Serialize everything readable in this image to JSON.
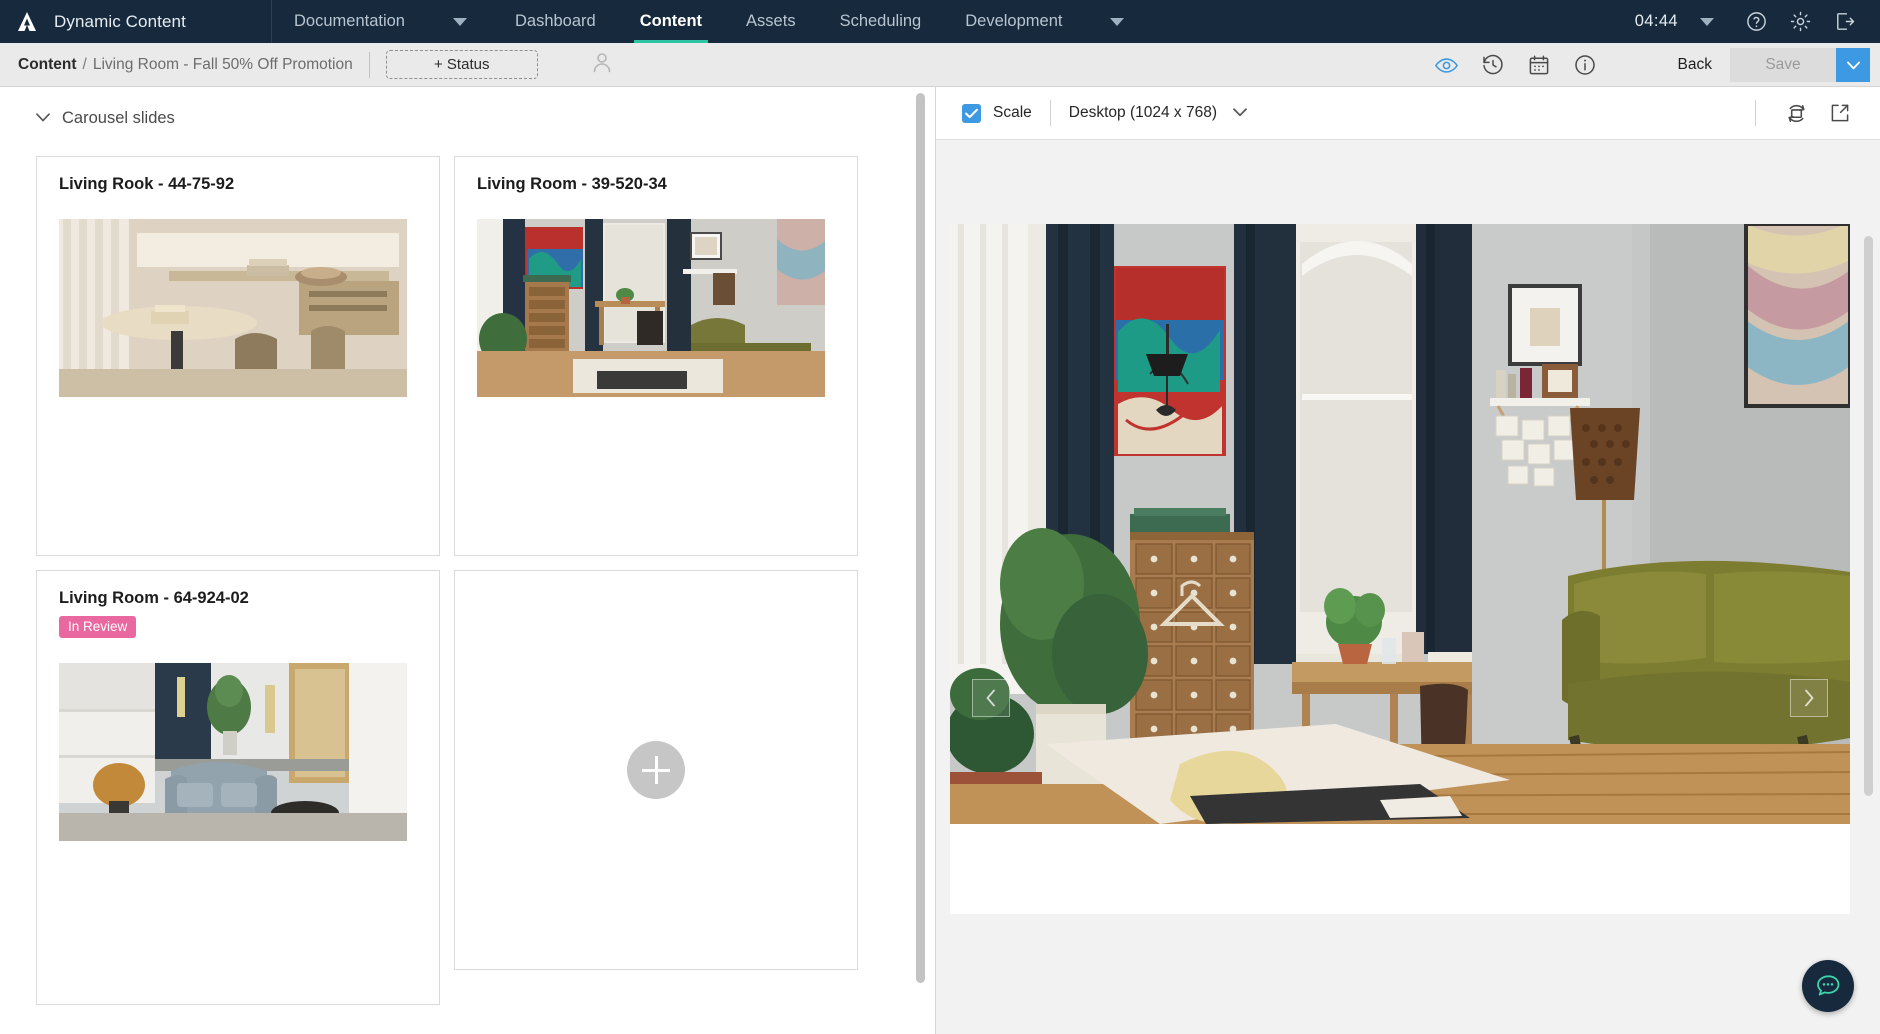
{
  "topnav": {
    "logo_icon": "amplience-logo-icon",
    "app_title": "Dynamic Content",
    "items": [
      {
        "label": "Documentation",
        "active": false,
        "has_caret": true
      },
      {
        "label": "Dashboard",
        "active": false,
        "has_caret": false
      },
      {
        "label": "Content",
        "active": true,
        "has_caret": false
      },
      {
        "label": "Assets",
        "active": false,
        "has_caret": false
      },
      {
        "label": "Scheduling",
        "active": false,
        "has_caret": false
      },
      {
        "label": "Development",
        "active": false,
        "has_caret": true
      }
    ],
    "clock": "04:44",
    "clock_caret_icon": "chevron-down-icon",
    "help_icon": "help-circle-icon",
    "settings_icon": "gear-icon",
    "logout_icon": "logout-icon",
    "accent_active": "#2ec4a4",
    "background": "#16293d"
  },
  "breadcrumb": {
    "root": "Content",
    "separator": "/",
    "leaf": "Living Room - Fall 50% Off Promotion",
    "status_button": "+ Status",
    "avatar_icon": "user-avatar-icon"
  },
  "actionbar": {
    "preview_icon": "eye-icon",
    "history_icon": "history-clock-icon",
    "schedule_icon": "calendar-icon",
    "info_icon": "info-circle-icon",
    "back_label": "Back",
    "save_label": "Save",
    "save_dropdown_icon": "chevron-down-icon",
    "save_enabled": false,
    "accent_blue": "#3d9ae2"
  },
  "left_panel": {
    "section": {
      "label": "Carousel slides",
      "collapse_icon": "chevron-down-icon",
      "expanded": true
    },
    "slides": [
      {
        "title": "Living Rook - 44-75-92",
        "badge": null,
        "image": "living-room-photo-1"
      },
      {
        "title": "Living Room - 39-520-34",
        "badge": null,
        "image": "living-room-photo-2"
      },
      {
        "title": "Living Room - 64-924-02",
        "badge": "In Review",
        "badge_color": "#e8689f",
        "image": "living-room-photo-3"
      }
    ],
    "add_slide": {
      "icon": "plus-icon",
      "label": ""
    },
    "scrollbar": "vertical-scrollbar"
  },
  "preview": {
    "scale_checkbox": {
      "label": "Scale",
      "checked": true
    },
    "device": {
      "label": "Desktop (1024 x 768)",
      "caret_icon": "chevron-down-icon"
    },
    "rotate_icon": "rotate-device-icon",
    "open_external_icon": "open-in-new-icon",
    "carousel": {
      "prev_icon": "chevron-left-icon",
      "next_icon": "chevron-right-icon"
    },
    "photo": "living-room-photo-2-large",
    "scrollbar": "vertical-scrollbar"
  },
  "chat": {
    "fab_icon": "chat-bubble-icon",
    "fab_bg": "#16293d",
    "fab_icon_color": "#2ec4a4"
  }
}
